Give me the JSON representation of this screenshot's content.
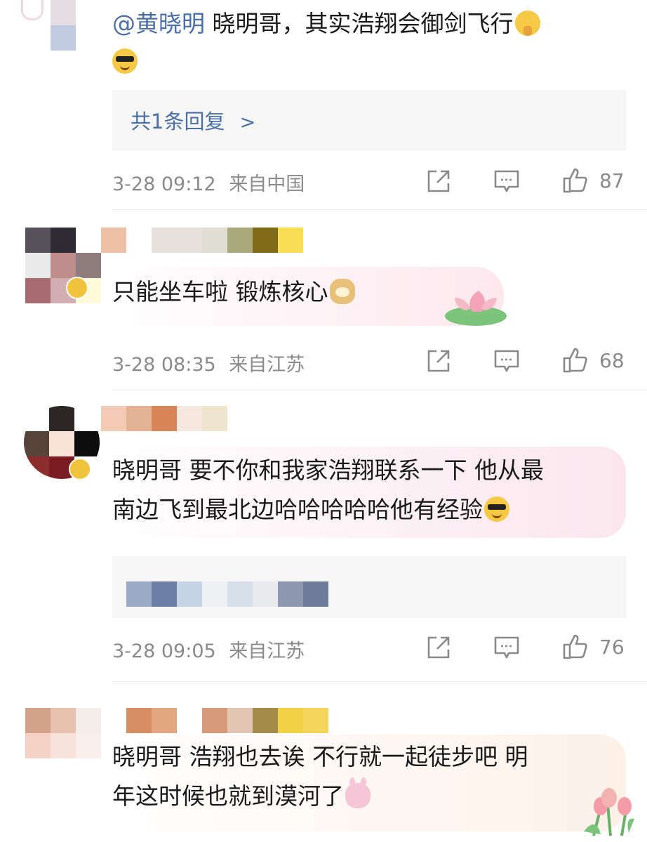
{
  "comments": [
    {
      "mention": "@黄晓明",
      "text_line1": " 晓明哥，其实浩翔会御剑飞行",
      "replies_label": "共1条回复",
      "replies_chevron": ">",
      "time": "3-28 09:12",
      "source": "来自中国",
      "likes": "87"
    },
    {
      "text_line1": "只能坐车啦 锻炼核心",
      "time": "3-28 08:35",
      "source": "来自江苏",
      "likes": "68"
    },
    {
      "text_line1": "晓明哥 要不你和我家浩翔联系一下 他从最",
      "text_line2": "南边飞到最北边哈哈哈哈哈他有经验",
      "time": "3-28 09:05",
      "source": "来自江苏",
      "likes": "76"
    },
    {
      "text_line1": "晓明哥 浩翔也去诶 不行就一起徒步吧 明",
      "text_line2": "年这时候也就到漠河了"
    }
  ],
  "icons": {
    "share": "share-icon",
    "comment": "comment-icon",
    "like": "thumbs-up-icon"
  },
  "colors": {
    "link_blue": "#4a6fa6",
    "meta_gray": "#8a8a8a",
    "reply_bg": "#f6f6f6"
  }
}
